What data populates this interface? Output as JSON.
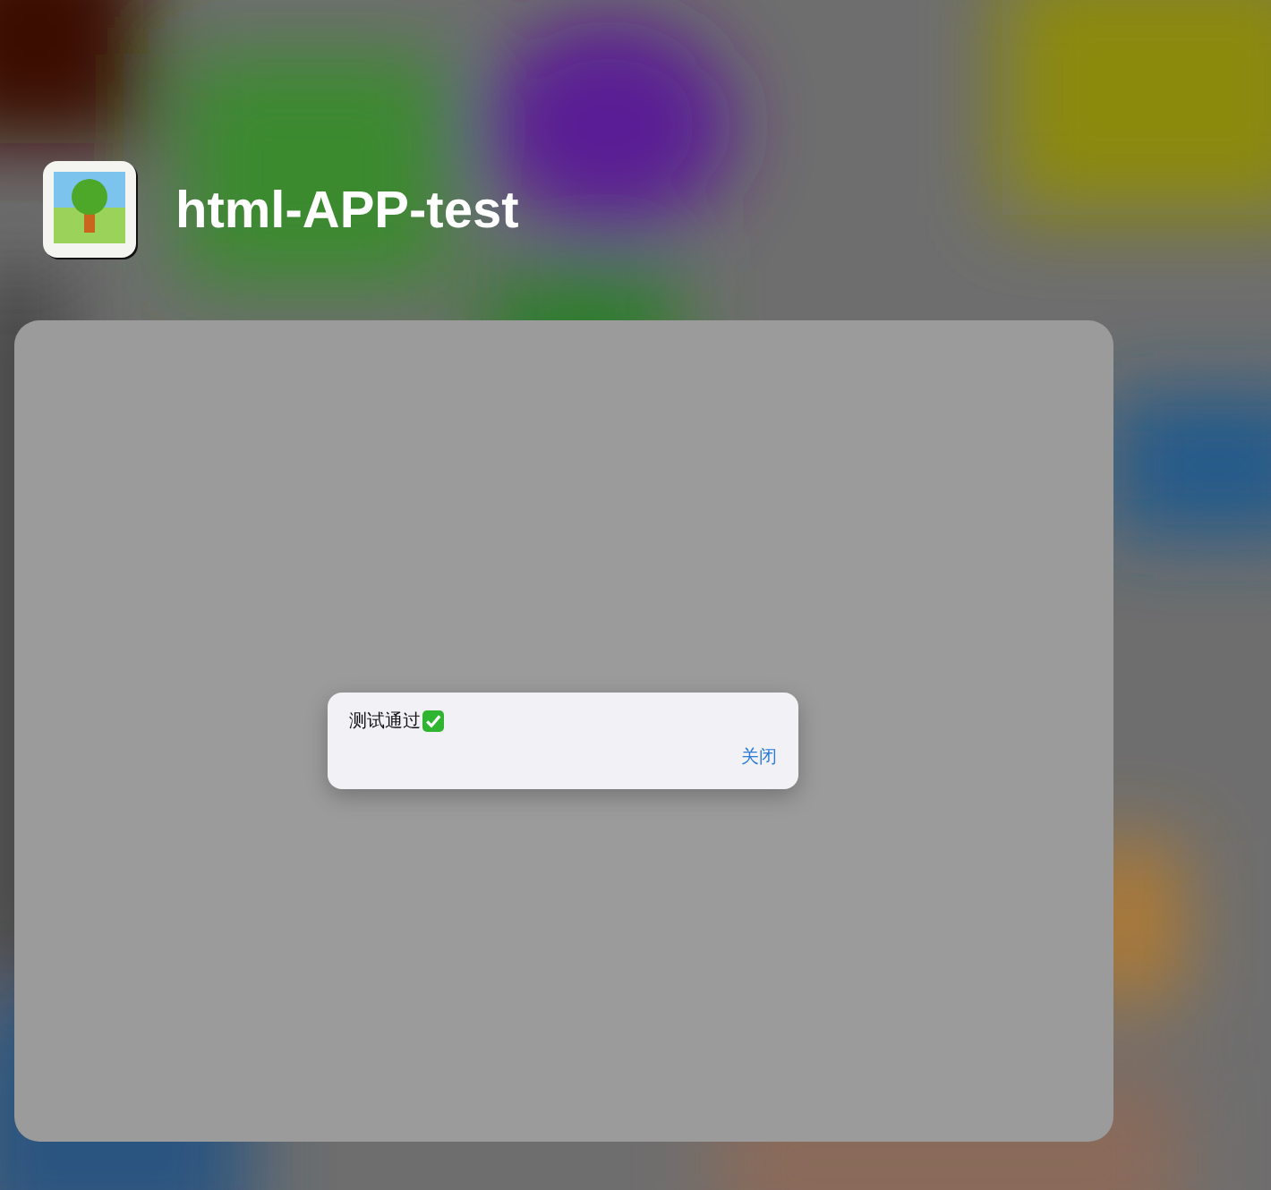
{
  "app": {
    "title": "html-APP-test"
  },
  "dialog": {
    "message": "测试通过",
    "buttons": [
      "关闭"
    ]
  }
}
